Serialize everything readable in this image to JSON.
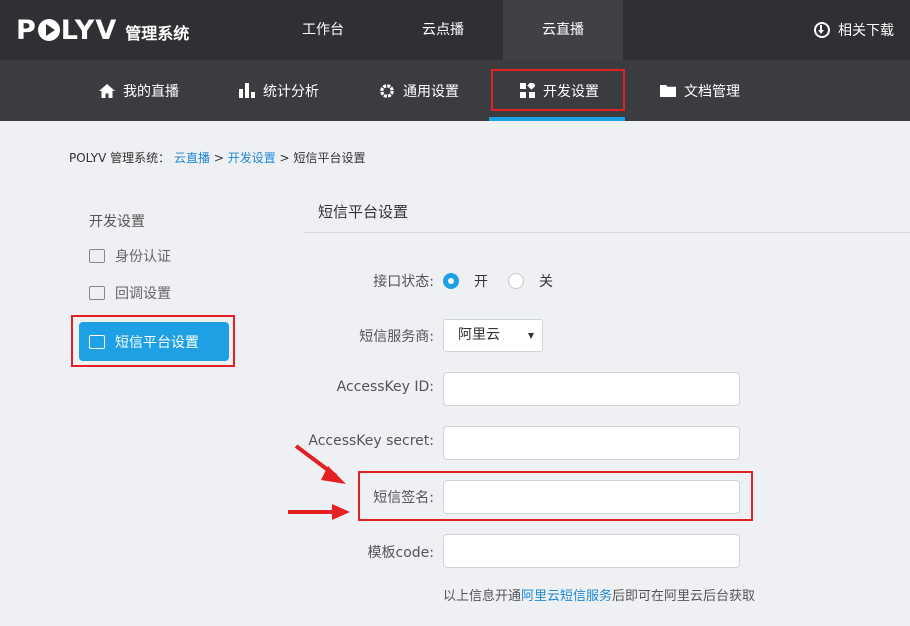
{
  "brand": {
    "logo_text": "POLYV",
    "subtitle": "管理系统"
  },
  "top_tabs": [
    {
      "label": "工作台"
    },
    {
      "label": "云点播"
    },
    {
      "label": "云直播"
    }
  ],
  "download_label": "相关下载",
  "sub_nav": [
    {
      "label": "我的直播",
      "icon": "home-icon"
    },
    {
      "label": "统计分析",
      "icon": "bar-chart-icon"
    },
    {
      "label": "通用设置",
      "icon": "gear-icon"
    },
    {
      "label": "开发设置",
      "icon": "grid-icon"
    },
    {
      "label": "文档管理",
      "icon": "folder-icon"
    }
  ],
  "breadcrumb": {
    "root": "POLYV 管理系统：",
    "crumb1": "云直播",
    "sep": ">",
    "crumb2": "开发设置",
    "current": "短信平台设置"
  },
  "sidebar": {
    "title": "开发设置",
    "items": [
      {
        "label": "身份认证",
        "icon": "id-card-icon"
      },
      {
        "label": "回调设置",
        "icon": "terminal-icon"
      },
      {
        "label": "短信平台设置",
        "icon": "terminal-icon"
      }
    ]
  },
  "section_title": "短信平台设置",
  "form": {
    "status_label": "接口状态:",
    "status_on": "开",
    "status_off": "关",
    "provider_label": "短信服务商:",
    "provider_value": "阿里云",
    "accesskey_id_label": "AccessKey ID:",
    "accesskey_id_value": "",
    "accesskey_secret_label": "AccessKey secret:",
    "accesskey_secret_value": "",
    "sign_label": "短信签名:",
    "sign_value": "",
    "template_label": "模板code:",
    "template_value": ""
  },
  "note": {
    "before": "以上信息开通",
    "link": "阿里云短信服务",
    "after": "后即可在阿里云后台获取"
  },
  "colors": {
    "accent": "#1ea0e4",
    "highlight": "#e32125",
    "topbar": "#2f3033",
    "subnav": "#3b3c40"
  }
}
